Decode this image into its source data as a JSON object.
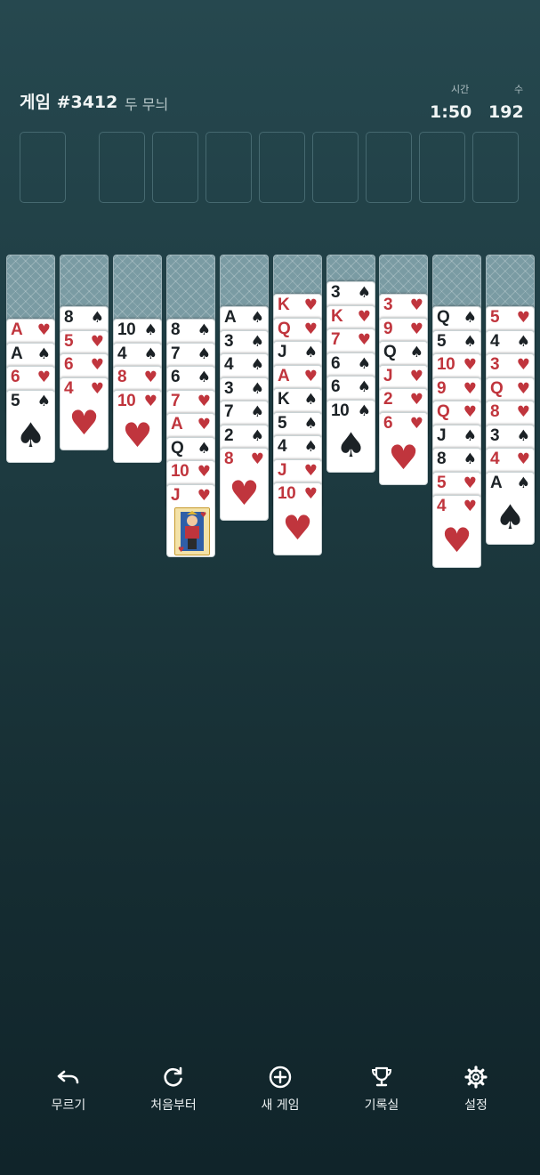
{
  "header": {
    "title": "게임 #3412",
    "subtitle": "두 무늬",
    "time_label": "시간",
    "time_value": "1:50",
    "moves_label": "수",
    "moves_value": "192"
  },
  "foundation_slot_count": 9,
  "colors": {
    "red": "#c0353d",
    "black": "#1c2226"
  },
  "columns": [
    {
      "facedown": 1,
      "cards": [
        {
          "rank": "A",
          "suit": "hearts"
        },
        {
          "rank": "A",
          "suit": "spades"
        },
        {
          "rank": "6",
          "suit": "hearts"
        },
        {
          "rank": "5",
          "suit": "spades"
        }
      ]
    },
    {
      "facedown": 1,
      "cards": [
        {
          "rank": "8",
          "suit": "spades"
        },
        {
          "rank": "5",
          "suit": "hearts"
        },
        {
          "rank": "6",
          "suit": "hearts"
        },
        {
          "rank": "4",
          "suit": "hearts"
        }
      ]
    },
    {
      "facedown": 1,
      "cards": [
        {
          "rank": "10",
          "suit": "spades"
        },
        {
          "rank": "4",
          "suit": "spades"
        },
        {
          "rank": "8",
          "suit": "hearts"
        },
        {
          "rank": "10",
          "suit": "hearts"
        }
      ]
    },
    {
      "facedown": 1,
      "cards": [
        {
          "rank": "8",
          "suit": "spades"
        },
        {
          "rank": "7",
          "suit": "spades"
        },
        {
          "rank": "6",
          "suit": "spades"
        },
        {
          "rank": "7",
          "suit": "hearts"
        },
        {
          "rank": "A",
          "suit": "hearts"
        },
        {
          "rank": "Q",
          "suit": "spades"
        },
        {
          "rank": "10",
          "suit": "hearts"
        },
        {
          "rank": "J",
          "suit": "hearts",
          "face": true
        }
      ]
    },
    {
      "facedown": 1,
      "cards": [
        {
          "rank": "A",
          "suit": "spades"
        },
        {
          "rank": "3",
          "suit": "spades"
        },
        {
          "rank": "4",
          "suit": "spades"
        },
        {
          "rank": "3",
          "suit": "spades"
        },
        {
          "rank": "7",
          "suit": "spades"
        },
        {
          "rank": "2",
          "suit": "spades"
        },
        {
          "rank": "8",
          "suit": "hearts"
        }
      ]
    },
    {
      "facedown": 1,
      "cards": [
        {
          "rank": "K",
          "suit": "hearts"
        },
        {
          "rank": "Q",
          "suit": "hearts"
        },
        {
          "rank": "J",
          "suit": "spades"
        },
        {
          "rank": "A",
          "suit": "hearts"
        },
        {
          "rank": "K",
          "suit": "spades"
        },
        {
          "rank": "5",
          "suit": "spades"
        },
        {
          "rank": "4",
          "suit": "spades"
        },
        {
          "rank": "J",
          "suit": "hearts"
        },
        {
          "rank": "10",
          "suit": "hearts"
        }
      ]
    },
    {
      "facedown": 1,
      "cards": [
        {
          "rank": "3",
          "suit": "spades"
        },
        {
          "rank": "K",
          "suit": "hearts"
        },
        {
          "rank": "7",
          "suit": "hearts"
        },
        {
          "rank": "6",
          "suit": "spades"
        },
        {
          "rank": "6",
          "suit": "spades"
        },
        {
          "rank": "10",
          "suit": "spades"
        }
      ]
    },
    {
      "facedown": 1,
      "cards": [
        {
          "rank": "3",
          "suit": "hearts"
        },
        {
          "rank": "9",
          "suit": "hearts"
        },
        {
          "rank": "Q",
          "suit": "spades"
        },
        {
          "rank": "J",
          "suit": "hearts"
        },
        {
          "rank": "2",
          "suit": "hearts"
        },
        {
          "rank": "6",
          "suit": "hearts"
        }
      ]
    },
    {
      "facedown": 1,
      "cards": [
        {
          "rank": "Q",
          "suit": "spades"
        },
        {
          "rank": "5",
          "suit": "spades"
        },
        {
          "rank": "10",
          "suit": "hearts"
        },
        {
          "rank": "9",
          "suit": "hearts"
        },
        {
          "rank": "Q",
          "suit": "hearts"
        },
        {
          "rank": "J",
          "suit": "spades"
        },
        {
          "rank": "8",
          "suit": "spades"
        },
        {
          "rank": "5",
          "suit": "hearts"
        },
        {
          "rank": "4",
          "suit": "hearts"
        }
      ]
    },
    {
      "facedown": 1,
      "cards": [
        {
          "rank": "5",
          "suit": "hearts"
        },
        {
          "rank": "4",
          "suit": "spades"
        },
        {
          "rank": "3",
          "suit": "hearts"
        },
        {
          "rank": "Q",
          "suit": "hearts"
        },
        {
          "rank": "8",
          "suit": "hearts"
        },
        {
          "rank": "3",
          "suit": "spades"
        },
        {
          "rank": "4",
          "suit": "hearts"
        },
        {
          "rank": "A",
          "suit": "spades"
        }
      ]
    }
  ],
  "toolbar": {
    "undo_label": "무르기",
    "undo_icon": "undo-icon",
    "restart_label": "처음부터",
    "restart_icon": "refresh-icon",
    "new_game_label": "새 게임",
    "new_game_icon": "plus-circle-icon",
    "records_label": "기록실",
    "records_icon": "trophy-icon",
    "settings_label": "설정",
    "settings_icon": "gear-icon"
  }
}
